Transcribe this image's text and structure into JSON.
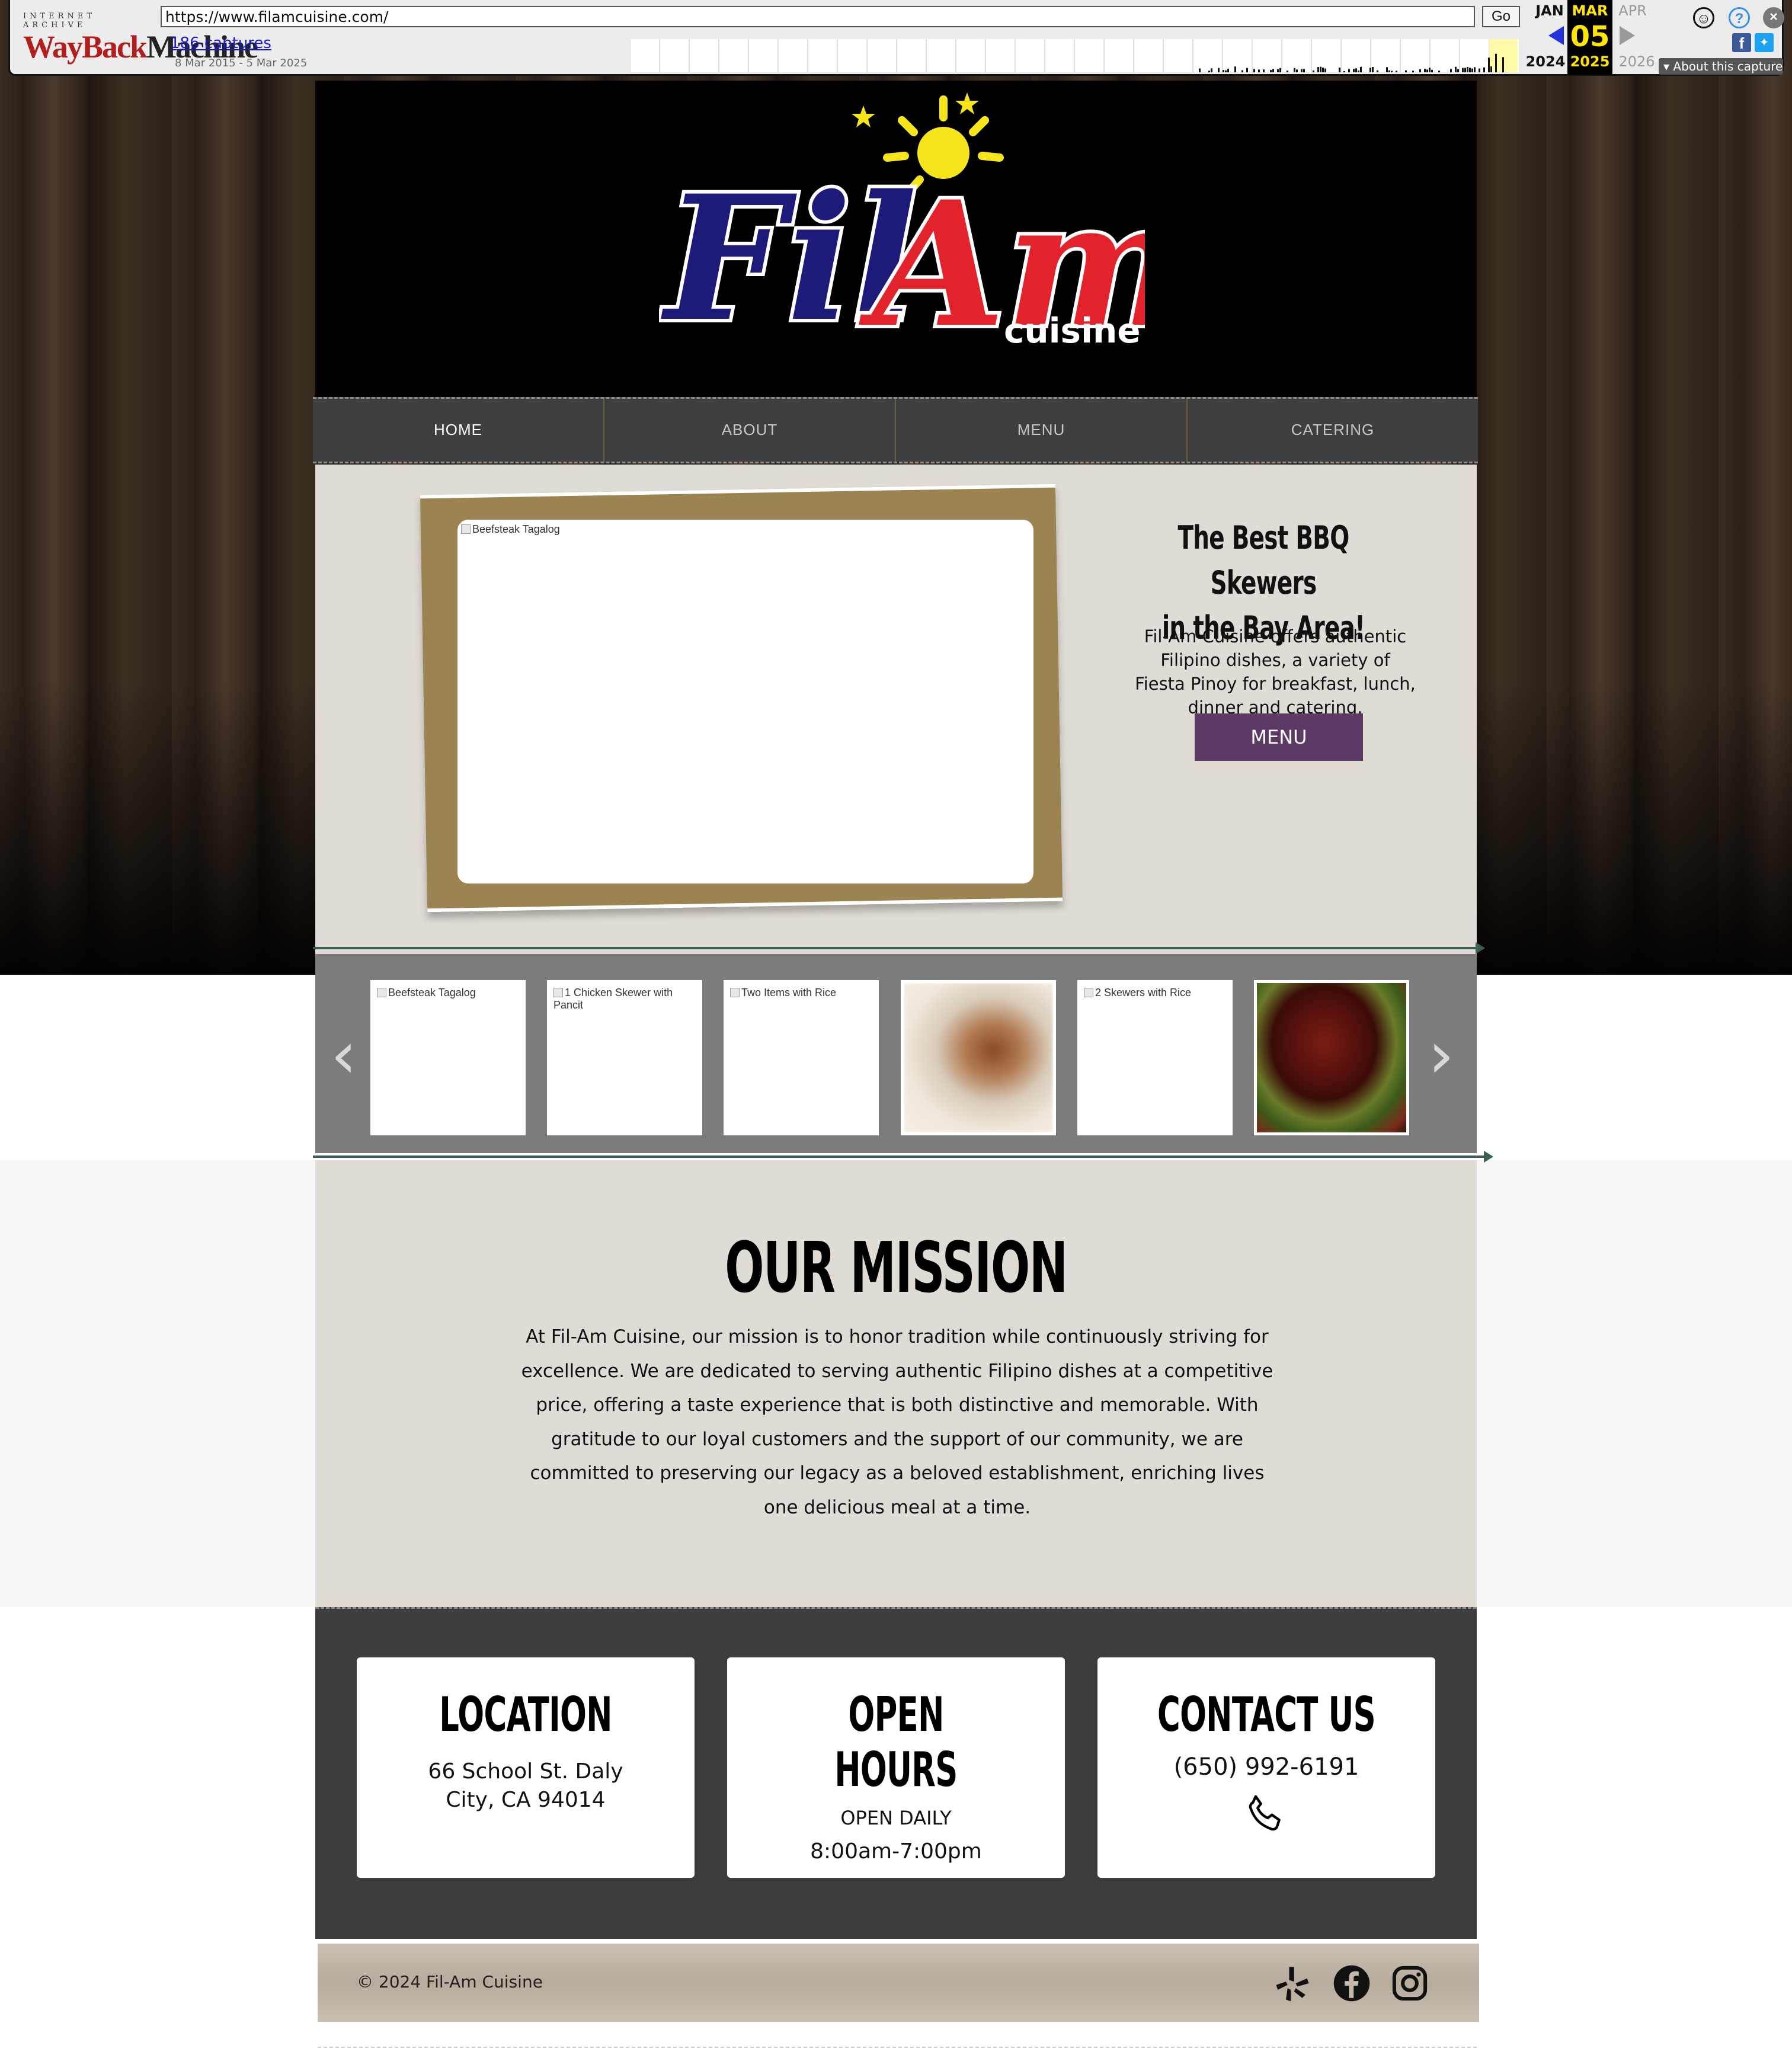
{
  "wayback": {
    "logo_top": "INTERNET ARCHIVE",
    "logo_way": "WayBack",
    "logo_machine": "Machine",
    "url": "https://www.filamcuisine.com/",
    "go_label": "Go",
    "captures_label": "186 captures",
    "date_range": "8 Mar 2015 - 5 Mar 2025",
    "prev_month": "JAN",
    "current_month": "MAR",
    "next_month": "APR",
    "current_day": "05",
    "prev_year": "2024",
    "current_year": "2025",
    "next_year": "2026",
    "about_label": "About this capture"
  },
  "brand": {
    "logo_fil": "Fil",
    "logo_am": "Am",
    "logo_cuisine": "cuisine"
  },
  "nav": {
    "items": [
      {
        "label": "HOME",
        "active": true
      },
      {
        "label": "ABOUT",
        "active": false
      },
      {
        "label": "MENU",
        "active": false
      },
      {
        "label": "CATERING",
        "active": false
      }
    ]
  },
  "hero": {
    "image_alt": "Beefsteak Tagalog",
    "title_line1": "The Best BBQ Skewers",
    "title_line2": "in the Bay Area!",
    "description": "Fil-Am Cuisine offers authentic Filipino dishes, a variety of Fiesta Pinoy for breakfast, lunch, dinner and catering.",
    "button_label": "MENU",
    "button_color": "#5d3a65"
  },
  "gallery": {
    "prev_arrow": "‹",
    "next_arrow": "›",
    "thumbs": [
      {
        "alt": "Beefsteak Tagalog",
        "kind": "broken"
      },
      {
        "alt": "1 Chicken Skewer with Pancit",
        "kind": "broken"
      },
      {
        "alt": "Two Items with Rice",
        "kind": "broken"
      },
      {
        "alt": "",
        "kind": "photo-blurred"
      },
      {
        "alt": "2 Skewers with Rice",
        "kind": "broken"
      },
      {
        "alt": "",
        "kind": "photo-bbq"
      }
    ]
  },
  "mission": {
    "title": "OUR MISSION",
    "text": "At Fil-Am Cuisine, our mission is to honor tradition while continuously striving for excellence. We are dedicated to serving authentic Filipino dishes at a competitive price, offering a taste experience that is both distinctive and memorable. With gratitude to our loyal customers and the support of our community, we are committed to preserving our legacy as a beloved establishment, enriching lives one delicious meal at a time."
  },
  "info": {
    "location": {
      "title": "LOCATION",
      "line1": "66 School St. Daly",
      "line2": "City, CA 94014"
    },
    "hours": {
      "title": "OPEN HOURS",
      "line1": "OPEN DAILY",
      "line2": "8:00am-7:00pm"
    },
    "contact": {
      "title": "CONTACT US",
      "phone": "(650) 992-6191",
      "icon": "phone-icon"
    }
  },
  "footer": {
    "copyright": "© 2024 Fil-Am Cuisine",
    "social": [
      "yelp-icon",
      "facebook-icon",
      "instagram-icon"
    ]
  },
  "colors": {
    "nav_bg": "#3f3f3f",
    "hero_bg": "#e0dbd4",
    "info_bg": "#3d3d3d",
    "logo_blue": "#1e1a7a",
    "logo_red": "#e3232b",
    "logo_sun": "#f6e51b"
  }
}
